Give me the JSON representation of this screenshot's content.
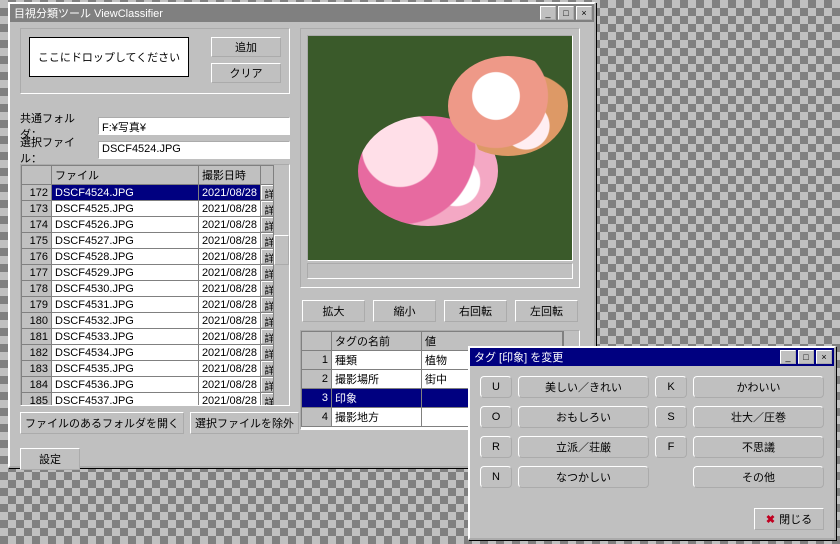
{
  "main": {
    "title": "目視分類ツール ViewClassifier",
    "drop_hint": "ここにドロップしてください",
    "add_label": "追加",
    "clear_label": "クリア",
    "folder_label": "共通フォルダ：",
    "folder_value": "F:¥写真¥",
    "selfile_label": "選択ファイル：",
    "selfile_value": "DSCF4524.JPG",
    "grid_headers": {
      "file": "ファイル",
      "datetime": "撮影日時"
    },
    "detail_label": "詳細",
    "rows": [
      {
        "n": 172,
        "file": "DSCF4524.JPG",
        "dt": "2021/08/28",
        "selected": true
      },
      {
        "n": 173,
        "file": "DSCF4525.JPG",
        "dt": "2021/08/28"
      },
      {
        "n": 174,
        "file": "DSCF4526.JPG",
        "dt": "2021/08/28"
      },
      {
        "n": 175,
        "file": "DSCF4527.JPG",
        "dt": "2021/08/28"
      },
      {
        "n": 176,
        "file": "DSCF4528.JPG",
        "dt": "2021/08/28"
      },
      {
        "n": 177,
        "file": "DSCF4529.JPG",
        "dt": "2021/08/28"
      },
      {
        "n": 178,
        "file": "DSCF4530.JPG",
        "dt": "2021/08/28"
      },
      {
        "n": 179,
        "file": "DSCF4531.JPG",
        "dt": "2021/08/28"
      },
      {
        "n": 180,
        "file": "DSCF4532.JPG",
        "dt": "2021/08/28"
      },
      {
        "n": 181,
        "file": "DSCF4533.JPG",
        "dt": "2021/08/28"
      },
      {
        "n": 182,
        "file": "DSCF4534.JPG",
        "dt": "2021/08/28"
      },
      {
        "n": 183,
        "file": "DSCF4535.JPG",
        "dt": "2021/08/28"
      },
      {
        "n": 184,
        "file": "DSCF4536.JPG",
        "dt": "2021/08/28"
      },
      {
        "n": 185,
        "file": "DSCF4537.JPG",
        "dt": "2021/08/28"
      }
    ],
    "open_folder_label": "ファイルのあるフォルダを開く",
    "remove_sel_label": "選択ファイルを除外",
    "settings_label": "設定",
    "img_buttons": {
      "zoom_in": "拡大",
      "zoom_out": "縮小",
      "rot_r": "右回転",
      "rot_l": "左回転"
    },
    "tag_headers": {
      "name": "タグの名前",
      "value": "値"
    },
    "tags": [
      {
        "n": 1,
        "name": "種類",
        "value": "植物"
      },
      {
        "n": 2,
        "name": "撮影場所",
        "value": "街中"
      },
      {
        "n": 3,
        "name": "印象",
        "value": "",
        "selected": true
      },
      {
        "n": 4,
        "name": "撮影地方",
        "value": ""
      }
    ]
  },
  "dialog": {
    "title": "タグ [印象] を変更",
    "options": [
      {
        "key": "U",
        "label": "美しい／きれい"
      },
      {
        "key": "K",
        "label": "かわいい"
      },
      {
        "key": "O",
        "label": "おもしろい"
      },
      {
        "key": "S",
        "label": "壮大／圧巻"
      },
      {
        "key": "R",
        "label": "立派／荘厳"
      },
      {
        "key": "F",
        "label": "不思議"
      },
      {
        "key": "N",
        "label": "なつかしい"
      },
      {
        "key": "",
        "label": "その他"
      }
    ],
    "close_label": "閉じる"
  }
}
